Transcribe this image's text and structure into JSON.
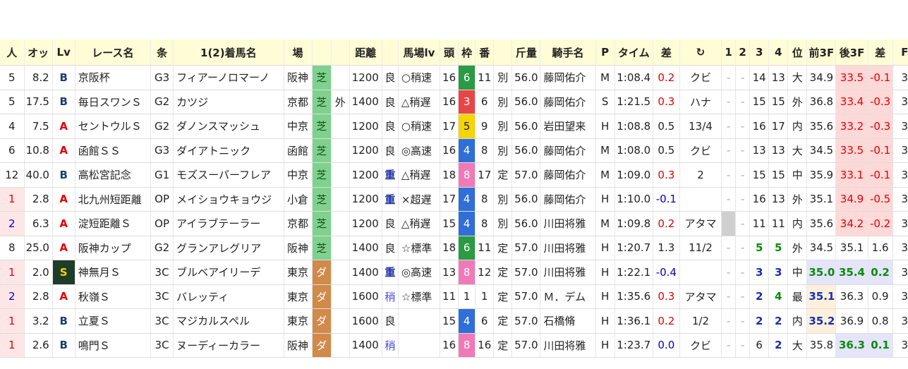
{
  "header": [
    "人",
    "オッ",
    "Lv",
    "レース名",
    "条",
    "1(2)着馬名",
    "場",
    "",
    "",
    "距離",
    "",
    "馬場lv",
    "頭",
    "枠",
    "番",
    "",
    "斤量",
    "騎手名",
    "P",
    "タイム",
    "差",
    "↻",
    "1",
    "2",
    "3",
    "4",
    "位",
    "前3F",
    "後3F",
    "差",
    "F"
  ],
  "frame_colors": {
    "1": "#ffffff",
    "3": "#e84545",
    "4": "#2f6fd6",
    "5": "#f3d50a",
    "6": "#2b9a44",
    "8": "#f07ab8",
    "7": "#f3a020",
    "2": "#2b2b2b"
  },
  "rows": [
    {
      "pop": "5",
      "odds": "8.2",
      "lv": "B",
      "race": "京阪杯",
      "cls": "G3",
      "horse": "フィアーノロマーノ",
      "place": "阪神",
      "surf": "芝",
      "inout": "",
      "dist": "1200",
      "cond": "良",
      "trk": "○稍速",
      "heads": "16",
      "frame": "6",
      "num": "11",
      "sex": "別",
      "wt": "56.0",
      "jockey": "藤岡佑介",
      "p": "M",
      "time": "1:08.4",
      "diff": "0.2",
      "diffc": "pos",
      "note": "クビ",
      "c1": "-",
      "c2": "-",
      "c3": "14",
      "c4": "13",
      "pos": "大",
      "f3": "34.9",
      "l3": "33.5",
      "l3c": "pink",
      "d2": "-0.1",
      "d2c": "pos pink",
      "f": "3"
    },
    {
      "pop": "5",
      "odds": "17.5",
      "lv": "B",
      "race": "毎日スワンＳ",
      "cls": "G2",
      "horse": "カツジ",
      "place": "京都",
      "surf": "芝",
      "inout": "外",
      "dist": "1400",
      "cond": "良",
      "trk": "△稍遅",
      "heads": "16",
      "frame": "3",
      "num": "6",
      "sex": "別",
      "wt": "56.0",
      "jockey": "藤岡佑介",
      "p": "S",
      "time": "1:21.5",
      "diff": "0.3",
      "diffc": "pos",
      "note": "ハナ",
      "c1": "-",
      "c2": "-",
      "c3": "15",
      "c4": "15",
      "pos": "外",
      "f3": "36.8",
      "l3": "33.4",
      "l3c": "pink",
      "d2": "-0.3",
      "d2c": "pos pink",
      "f": "3"
    },
    {
      "pop": "4",
      "odds": "7.5",
      "lv": "A",
      "race": "セントウルＳ",
      "cls": "G2",
      "horse": "ダノンスマッシュ",
      "place": "中京",
      "surf": "芝",
      "inout": "",
      "dist": "1200",
      "cond": "良",
      "trk": "○稍速",
      "heads": "17",
      "frame": "5",
      "num": "9",
      "sex": "別",
      "wt": "56.0",
      "jockey": "岩田望来",
      "p": "H",
      "time": "1:08.8",
      "diff": "0.5",
      "diffc": "",
      "note": "13/4",
      "c1": "-",
      "c2": "-",
      "c3": "16",
      "c4": "17",
      "pos": "内",
      "f3": "35.6",
      "l3": "33.2",
      "l3c": "pink",
      "d2": "-0.3",
      "d2c": "pos pink",
      "f": "3"
    },
    {
      "pop": "6",
      "odds": "10.8",
      "lv": "A",
      "race": "函館ＳＳ",
      "cls": "G3",
      "horse": "ダイアトニック",
      "place": "函館",
      "surf": "芝",
      "inout": "",
      "dist": "1200",
      "cond": "良",
      "trk": "◎高速",
      "heads": "16",
      "frame": "4",
      "num": "8",
      "sex": "別",
      "wt": "56.0",
      "jockey": "藤岡佑介",
      "p": "M",
      "time": "1:08.0",
      "diff": "0.5",
      "diffc": "",
      "note": "クビ",
      "c1": "-",
      "c2": "-",
      "c3": "13",
      "c4": "13",
      "pos": "大",
      "f3": "34.5",
      "l3": "33.5",
      "l3c": "pink",
      "d2": "-0.1",
      "d2c": "pos pink",
      "f": "3"
    },
    {
      "pop": "12",
      "odds": "40.0",
      "lv": "B",
      "race": "高松宮記念",
      "cls": "G1",
      "horse": "モズスーパーフレア",
      "place": "中京",
      "surf": "芝",
      "inout": "",
      "dist": "1200",
      "cond": "重",
      "trk": "△稍遅",
      "heads": "18",
      "frame": "8",
      "num": "17",
      "sex": "定",
      "wt": "57.0",
      "jockey": "藤岡佑介",
      "p": "M",
      "time": "1:09.0",
      "diff": "0.3",
      "diffc": "pos",
      "note": "2",
      "c1": "-",
      "c2": "-",
      "c3": "15",
      "c4": "15",
      "pos": "中",
      "f3": "35.9",
      "l3": "33.1",
      "l3c": "pink",
      "d2": "-0.1",
      "d2c": "pos pink",
      "f": "3"
    },
    {
      "pop": "1",
      "odds": "2.8",
      "lv": "A",
      "race": "北九州短距離",
      "cls": "OP",
      "horse": "メイショウキョウジ",
      "place": "小倉",
      "surf": "芝",
      "inout": "",
      "dist": "1200",
      "cond": "重",
      "trk": "×超遅",
      "heads": "17",
      "frame": "4",
      "num": "8",
      "sex": "別",
      "wt": "56.0",
      "jockey": "藤岡佑介",
      "p": "H",
      "time": "1:10.0",
      "diff": "-0.1",
      "diffc": "neg",
      "note": "",
      "c1": "-",
      "c2": "-",
      "c3": "16",
      "c4": "13",
      "pos": "外",
      "f3": "35.1",
      "l3": "34.9",
      "l3c": "pink",
      "d2": "-0.5",
      "d2c": "pos pink",
      "f": "3"
    },
    {
      "pop": "2",
      "odds": "6.3",
      "lv": "A",
      "race": "淀短距離Ｓ",
      "cls": "OP",
      "horse": "アイラブテーラー",
      "place": "京都",
      "surf": "芝",
      "inout": "",
      "dist": "1200",
      "cond": "良",
      "trk": "△稍遅",
      "heads": "15",
      "frame": "4",
      "num": "8",
      "sex": "別",
      "wt": "56.0",
      "jockey": "川田将雅",
      "p": "M",
      "time": "1:09.8",
      "diff": "0.2",
      "diffc": "pos",
      "note": "アタマ",
      "c1": "g",
      "c2": "-",
      "c3": "11",
      "c4": "11",
      "pos": "内",
      "f3": "35.6",
      "l3": "34.2",
      "l3c": "pink",
      "d2": "-0.2",
      "d2c": "pos pink",
      "f": "3"
    },
    {
      "pop": "8",
      "odds": "25.0",
      "lv": "A",
      "race": "阪神カップ",
      "cls": "G2",
      "horse": "グランアレグリア",
      "place": "阪神",
      "surf": "芝",
      "inout": "",
      "dist": "1400",
      "cond": "良",
      "trk": "☆標準",
      "heads": "18",
      "frame": "6",
      "num": "11",
      "sex": "定",
      "wt": "57.0",
      "jockey": "川田将雅",
      "p": "H",
      "time": "1:20.7",
      "diff": "1.3",
      "diffc": "",
      "note": "11/2",
      "c1": "-",
      "c2": "-",
      "c3": "5",
      "c4": "5",
      "pos": "外",
      "f3": "34.5",
      "l3": "35.1",
      "l3c": "",
      "d2": "1.6",
      "d2c": "",
      "f": "3",
      "c34c": "p-green"
    },
    {
      "pop": "1",
      "odds": "2.0",
      "lv": "S",
      "race": "神無月Ｓ",
      "cls": "3C",
      "horse": "ブルベアイリーデ",
      "place": "東京",
      "surf": "ダ",
      "inout": "",
      "dist": "1400",
      "cond": "重",
      "trk": "◎高速",
      "heads": "13",
      "frame": "8",
      "num": "12",
      "sex": "定",
      "wt": "57.0",
      "jockey": "川田将雅",
      "p": "H",
      "time": "1:22.1",
      "diff": "-0.4",
      "diffc": "neg",
      "note": "",
      "c1": "-",
      "c2": "-",
      "c3": "3",
      "c4": "3",
      "pos": "中",
      "f3": "35.0",
      "f3c": "blue p-green",
      "l3": "35.4",
      "l3c": "blue p-green",
      "d2": "0.2",
      "d2c": "blue p-green",
      "f": "3",
      "c34c": "p-blue"
    },
    {
      "pop": "2",
      "odds": "2.8",
      "lv": "A",
      "race": "秋嶺Ｓ",
      "cls": "3C",
      "horse": "バレッティ",
      "place": "東京",
      "surf": "ダ",
      "inout": "",
      "dist": "1600",
      "cond": "稍",
      "trk": "☆標準",
      "heads": "11",
      "frame": "1",
      "num": "1",
      "sex": "定",
      "wt": "57.0",
      "jockey": "Ｍ．デム",
      "p": "H",
      "time": "1:35.6",
      "diff": "0.3",
      "diffc": "pos",
      "note": "アタマ",
      "c1": "-",
      "c2": "-",
      "c3": "2",
      "c4": "4",
      "pos": "最",
      "f3": "35.1",
      "f3c": "peach p-blue",
      "l3": "36.3",
      "l3c": "",
      "d2": "0.9",
      "d2c": "",
      "f": "3",
      "c34c": "p-blue",
      "c4c": "p-green"
    },
    {
      "pop": "1",
      "odds": "3.2",
      "lv": "B",
      "race": "立夏Ｓ",
      "cls": "3C",
      "horse": "マジカルスペル",
      "place": "東京",
      "surf": "ダ",
      "inout": "",
      "dist": "1600",
      "cond": "良",
      "trk": "",
      "heads": "15",
      "frame": "4",
      "num": "6",
      "sex": "定",
      "wt": "57.0",
      "jockey": "石橋脩",
      "p": "H",
      "time": "1:36.1",
      "diff": "0.2",
      "diffc": "pos",
      "note": "1/2",
      "c1": "-",
      "c2": "-",
      "c3": "2",
      "c4": "2",
      "pos": "内",
      "f3": "35.2",
      "f3c": "peach p-blue",
      "l3": "36.9",
      "l3c": "",
      "d2": "0.8",
      "d2c": "",
      "f": "3",
      "c34c": "p-blue"
    },
    {
      "pop": "1",
      "odds": "2.6",
      "lv": "B",
      "race": "鳴門Ｓ",
      "cls": "3C",
      "horse": "ヌーディーカラー",
      "place": "阪神",
      "surf": "ダ",
      "inout": "",
      "dist": "1400",
      "cond": "稍",
      "trk": "",
      "heads": "16",
      "frame": "8",
      "num": "16",
      "sex": "定",
      "wt": "57.0",
      "jockey": "川田将雅",
      "p": "H",
      "time": "1:23.7",
      "diff": "0.0",
      "diffc": "neg",
      "note": "クビ",
      "c1": "-",
      "c2": "-",
      "c3": "6",
      "c4": "2",
      "pos": "大",
      "f3": "35.8",
      "l3": "36.3",
      "l3c": "blue p-green",
      "d2": "0.1",
      "d2c": "blue p-green",
      "f": "3",
      "c4c": "p-blue"
    }
  ]
}
